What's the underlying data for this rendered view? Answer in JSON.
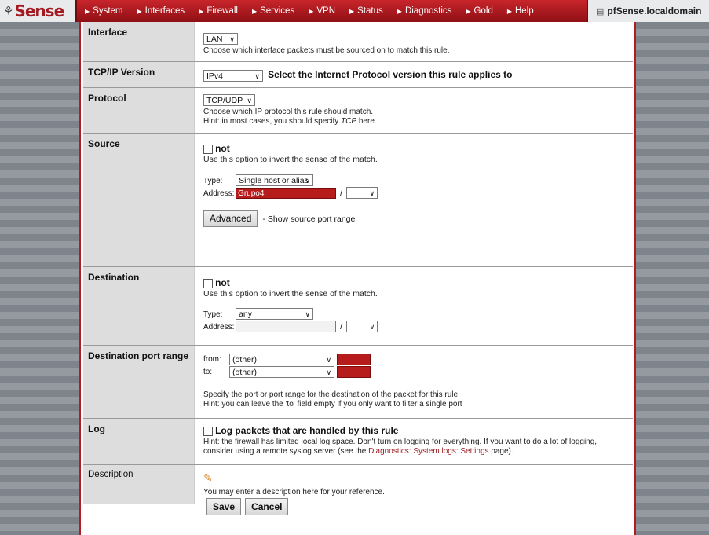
{
  "app": {
    "logo": "Sense",
    "hostname": "pfSense.localdomain"
  },
  "nav": [
    "System",
    "Interfaces",
    "Firewall",
    "Services",
    "VPN",
    "Status",
    "Diagnostics",
    "Gold",
    "Help"
  ],
  "interface": {
    "label": "Interface",
    "value": "LAN",
    "hint": "Choose which interface packets must be sourced on to match this rule."
  },
  "tcpip": {
    "label": "TCP/IP Version",
    "value": "IPv4",
    "note": "Select the Internet Protocol version this rule applies to"
  },
  "protocol": {
    "label": "Protocol",
    "value": "TCP/UDP",
    "hint1": "Choose which IP protocol this rule should match.",
    "hint2_pre": "Hint: in most cases, you should specify",
    "hint2_em": "TCP",
    "hint2_post": "here."
  },
  "source": {
    "label": "Source",
    "not_label": "not",
    "hint": "Use this option to invert the sense of the match.",
    "type_label": "Type:",
    "type_value": "Single host or alias",
    "address_label": "Address:",
    "address_value": "Grupo4",
    "slash": "/",
    "advanced_button": "Advanced",
    "advanced_note": "- Show source port range"
  },
  "destination": {
    "label": "Destination",
    "not_label": "not",
    "hint": "Use this option to invert the sense of the match.",
    "type_label": "Type:",
    "type_value": "any",
    "address_label": "Address:",
    "slash": "/"
  },
  "dest_port": {
    "label": "Destination port range",
    "from_label": "from:",
    "from_value": "(other)",
    "to_label": "to:",
    "to_value": "(other)",
    "hint1": "Specify the port or port range for the destination of the packet for this rule.",
    "hint2": "Hint: you can leave the 'to' field empty if you only want to filter a single port"
  },
  "log": {
    "label": "Log",
    "check_label": "Log packets that are handled by this rule",
    "hint1": "Hint: the firewall has limited local log space. Don't turn on logging for everything. If you want to do a lot of logging,",
    "hint2_pre": "consider using a remote syslog server (see the",
    "hint2_link": "Diagnostics: System logs: Settings",
    "hint2_post": "page)."
  },
  "description": {
    "label": "Description",
    "hint": "You may enter a description here for your reference."
  },
  "buttons": {
    "save": "Save",
    "cancel": "Cancel"
  },
  "colors": {
    "accent": "#b11d23",
    "alias_fill": "#b71c1c"
  }
}
